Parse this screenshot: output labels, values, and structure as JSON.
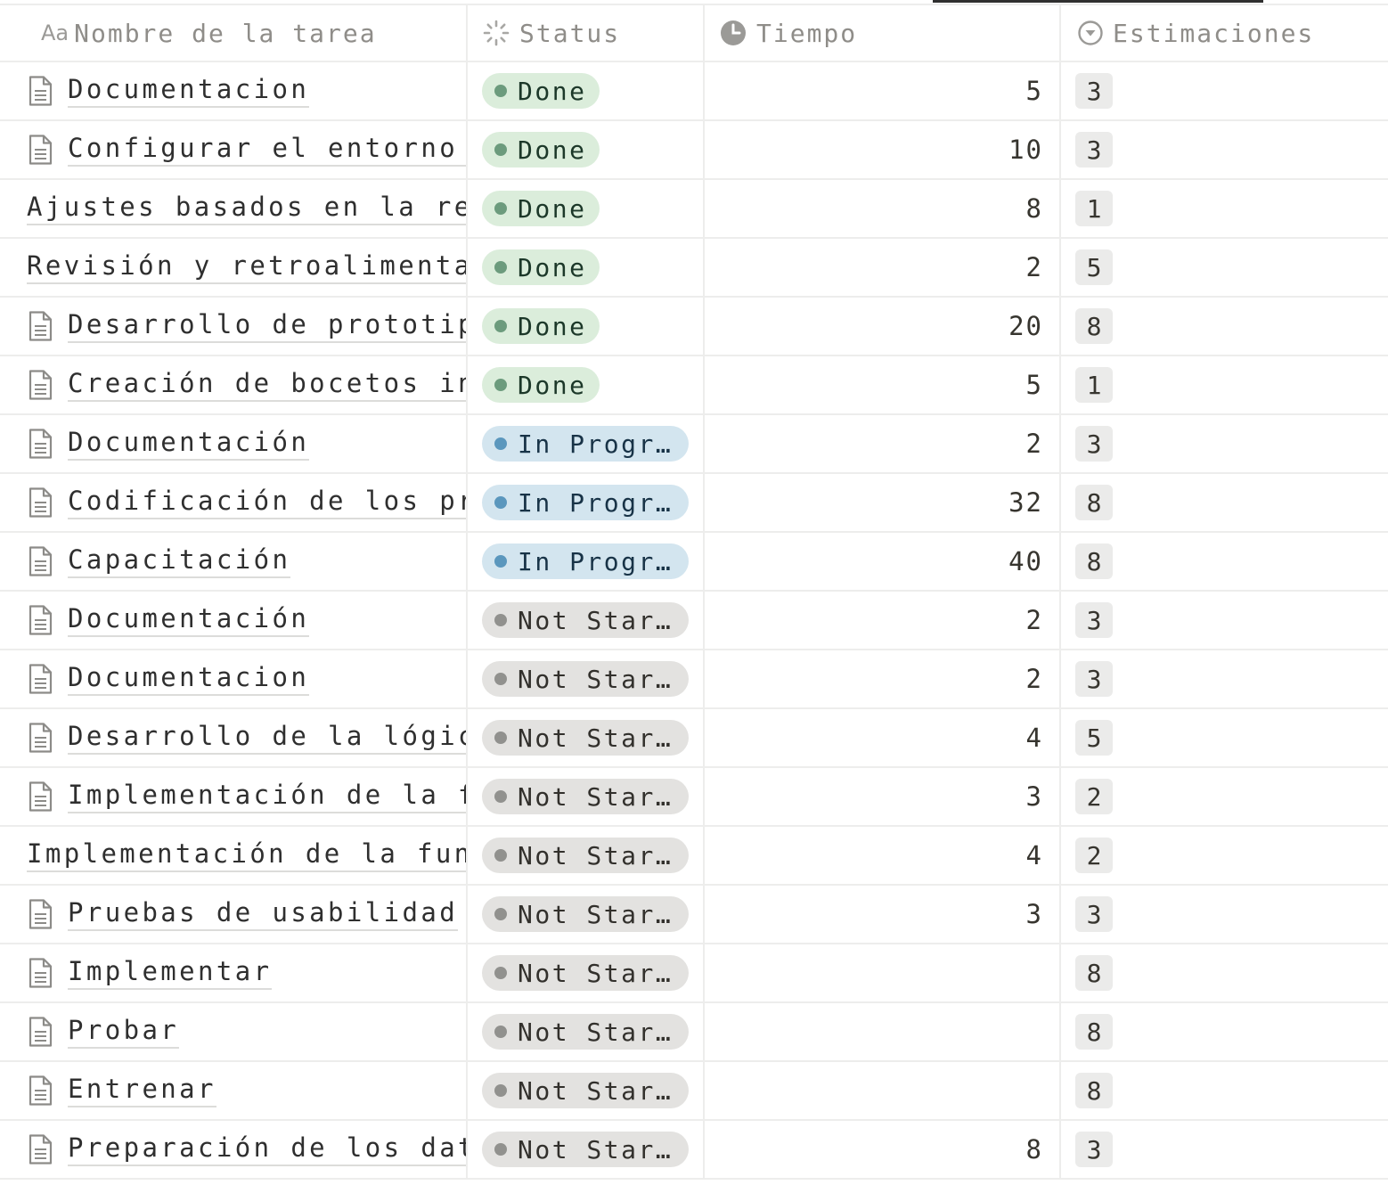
{
  "header": {
    "name_icon": "Aa",
    "name_label": "Nombre de la tarea",
    "status_label": "Status",
    "time_label": "Tiempo",
    "est_label": "Estimaciones"
  },
  "icons": {
    "status": "status-spinner-icon",
    "time": "clock-icon",
    "estimaciones": "select-chevron-icon",
    "row": "document-icon"
  },
  "colors": {
    "done_bg": "#dbeddb",
    "done_dot": "#6c9b7d",
    "in_progress_bg": "#d3e5ef",
    "in_progress_dot": "#5b97bd",
    "not_started_bg": "#e3e2e0",
    "not_started_dot": "#91918e"
  },
  "rows": [
    {
      "name": "Documentacion",
      "has_icon": true,
      "status": "Done",
      "status_type": "done",
      "time": "5",
      "est": "3"
    },
    {
      "name": "Configurar el entorno de",
      "has_icon": true,
      "status": "Done",
      "status_type": "done",
      "time": "10",
      "est": "3"
    },
    {
      "name": "Ajustes basados en la retro",
      "has_icon": false,
      "status": "Done",
      "status_type": "done",
      "time": "8",
      "est": "1"
    },
    {
      "name": "Revisión y retroalimentació",
      "has_icon": false,
      "status": "Done",
      "status_type": "done",
      "time": "2",
      "est": "5"
    },
    {
      "name": "Desarrollo de prototipos",
      "has_icon": true,
      "status": "Done",
      "status_type": "done",
      "time": "20",
      "est": "8"
    },
    {
      "name": "Creación de bocetos inic:",
      "has_icon": true,
      "status": "Done",
      "status_type": "done",
      "time": "5",
      "est": "1"
    },
    {
      "name": "Documentación",
      "has_icon": true,
      "status": "In Progr…",
      "status_type": "prog",
      "time": "2",
      "est": "3"
    },
    {
      "name": "Codificación de los proto",
      "has_icon": true,
      "status": "In Progr…",
      "status_type": "prog",
      "time": "32",
      "est": "8"
    },
    {
      "name": "Capacitación",
      "has_icon": true,
      "status": "In Progr…",
      "status_type": "prog",
      "time": "40",
      "est": "8"
    },
    {
      "name": "Documentación",
      "has_icon": true,
      "status": "Not Star…",
      "status_type": "not",
      "time": "2",
      "est": "3"
    },
    {
      "name": "Documentacion",
      "has_icon": true,
      "status": "Not Star…",
      "status_type": "not",
      "time": "2",
      "est": "3"
    },
    {
      "name": "Desarrollo de la lógica p",
      "has_icon": true,
      "status": "Not Star…",
      "status_type": "not",
      "time": "4",
      "est": "5"
    },
    {
      "name": "Implementación de la func",
      "has_icon": true,
      "status": "Not Star…",
      "status_type": "not",
      "time": "3",
      "est": "2"
    },
    {
      "name": "Implementación de la funcio",
      "has_icon": false,
      "status": "Not Star…",
      "status_type": "not",
      "time": "4",
      "est": "2"
    },
    {
      "name": "Pruebas de usabilidad",
      "has_icon": true,
      "status": "Not Star…",
      "status_type": "not",
      "time": "3",
      "est": "3"
    },
    {
      "name": "Implementar",
      "has_icon": true,
      "status": "Not Star…",
      "status_type": "not",
      "time": "",
      "est": "8"
    },
    {
      "name": "Probar",
      "has_icon": true,
      "status": "Not Star…",
      "status_type": "not",
      "time": "",
      "est": "8"
    },
    {
      "name": "Entrenar",
      "has_icon": true,
      "status": "Not Star…",
      "status_type": "not",
      "time": "",
      "est": "8"
    },
    {
      "name": "Preparación de los datos",
      "has_icon": true,
      "status": "Not Star…",
      "status_type": "not",
      "time": "8",
      "est": "3"
    }
  ]
}
